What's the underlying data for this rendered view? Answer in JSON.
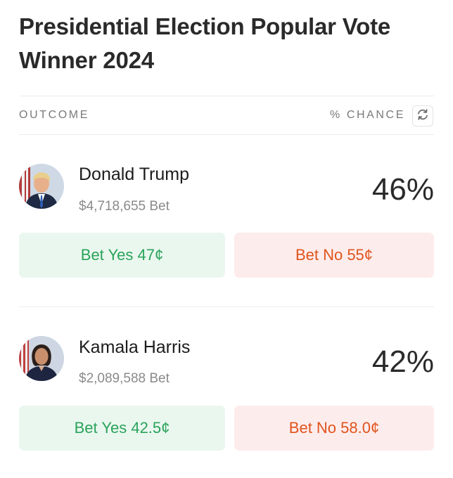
{
  "market": {
    "title": "Presidential Election Popular Vote Winner 2024"
  },
  "table": {
    "outcome_header": "OUTCOME",
    "chance_header": "% CHANCE",
    "refresh_icon": "refresh-icon"
  },
  "outcomes": [
    {
      "name": "Donald Trump",
      "volume": "$4,718,655 Bet",
      "chance": "46%",
      "bet_yes": "Bet Yes 47¢",
      "bet_no": "Bet No 55¢"
    },
    {
      "name": "Kamala Harris",
      "volume": "$2,089,588 Bet",
      "chance": "42%",
      "bet_yes": "Bet Yes 42.5¢",
      "bet_no": "Bet No 58.0¢"
    }
  ],
  "colors": {
    "yes_text": "#2aa35a",
    "yes_bg": "#eaf7ef",
    "no_text": "#e0541c",
    "no_bg": "#fdecec"
  }
}
